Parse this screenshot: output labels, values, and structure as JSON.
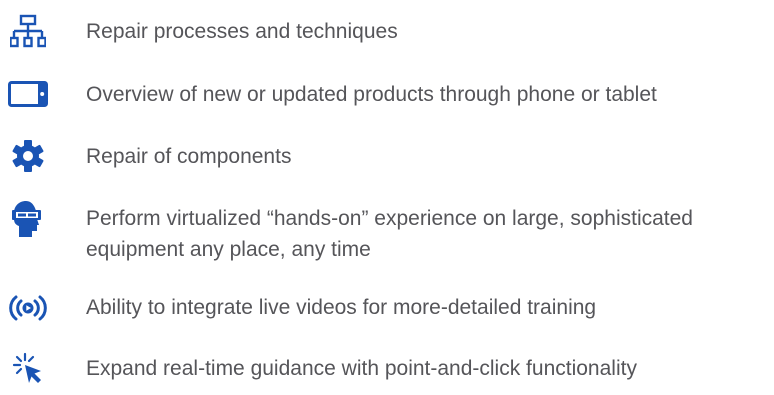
{
  "colors": {
    "icon_blue": "#1a54b4",
    "text_gray": "#555559"
  },
  "features": [
    {
      "icon": "hierarchy-icon",
      "label": "Repair processes and techniques"
    },
    {
      "icon": "tablet-icon",
      "label": "Overview of new or updated products through phone or tablet"
    },
    {
      "icon": "gear-icon",
      "label": "Repair of components"
    },
    {
      "icon": "vr-headset-icon",
      "label": "Perform virtualized “hands-on” experience on large, sophisticated equipment any place, any time"
    },
    {
      "icon": "live-broadcast-icon",
      "label": "Ability to integrate live videos for more-detailed training"
    },
    {
      "icon": "cursor-click-icon",
      "label": "Expand real-time guidance with point-and-click functionality"
    }
  ]
}
